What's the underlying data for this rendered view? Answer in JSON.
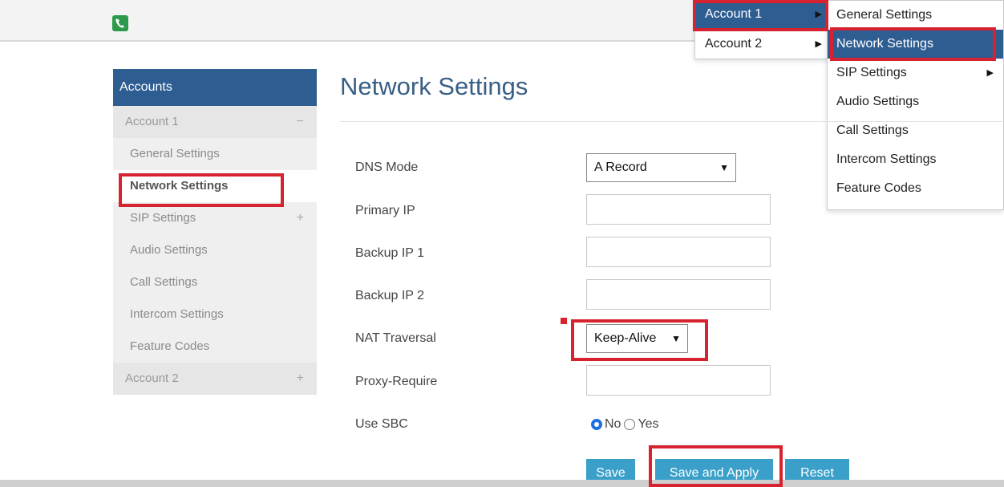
{
  "account_menu": {
    "items": [
      {
        "label": "Account 1"
      },
      {
        "label": "Account 2"
      }
    ]
  },
  "submenu": {
    "items": [
      {
        "label": "General Settings"
      },
      {
        "label": "Network Settings"
      },
      {
        "label": "SIP Settings"
      },
      {
        "label": "Audio Settings"
      },
      {
        "label": "Call Settings"
      },
      {
        "label": "Intercom Settings"
      },
      {
        "label": "Feature Codes"
      }
    ]
  },
  "sidebar": {
    "header": "Accounts",
    "account1": "Account 1",
    "account1_toggle": "−",
    "items": [
      {
        "label": "General Settings"
      },
      {
        "label": "Network Settings"
      },
      {
        "label": "SIP Settings"
      },
      {
        "label": "Audio Settings"
      },
      {
        "label": "Call Settings"
      },
      {
        "label": "Intercom Settings"
      },
      {
        "label": "Feature Codes"
      }
    ],
    "account2": "Account 2",
    "plus": "+"
  },
  "main": {
    "title": "Network Settings",
    "dns_mode": {
      "label": "DNS Mode",
      "value": "A Record"
    },
    "primary_ip": {
      "label": "Primary IP",
      "value": ""
    },
    "backup_ip1": {
      "label": "Backup IP 1",
      "value": ""
    },
    "backup_ip2": {
      "label": "Backup IP 2",
      "value": ""
    },
    "nat": {
      "label": "NAT Traversal",
      "value": "Keep-Alive"
    },
    "proxy_require": {
      "label": "Proxy-Require",
      "value": ""
    },
    "use_sbc": {
      "label": "Use SBC",
      "options": [
        "No",
        "Yes"
      ],
      "selected": "No"
    }
  },
  "buttons": {
    "save": "Save",
    "save_apply": "Save and Apply",
    "reset": "Reset"
  },
  "colors": {
    "accent": "#2e5d92",
    "button": "#3aa0c9",
    "highlight": "#d6232f"
  }
}
